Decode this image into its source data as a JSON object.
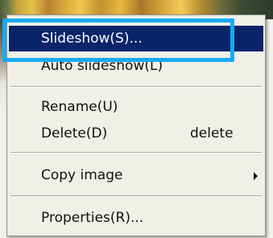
{
  "menu": {
    "items": [
      {
        "label": "Slideshow(S)...",
        "shortcut": "",
        "selected": true,
        "submenu": false
      },
      {
        "label": "Auto slideshow(L)",
        "shortcut": "",
        "selected": false,
        "submenu": false
      },
      {
        "label": "Rename(U)",
        "shortcut": "",
        "selected": false,
        "submenu": false
      },
      {
        "label": "Delete(D)",
        "shortcut": "delete",
        "selected": false,
        "submenu": false
      },
      {
        "label": "Copy image",
        "shortcut": "",
        "selected": false,
        "submenu": true
      },
      {
        "label": "Properties(R)...",
        "shortcut": "",
        "selected": false,
        "submenu": false
      }
    ]
  },
  "colors": {
    "selection_bg": "#0a246a",
    "selection_text": "#ffffff",
    "highlight_border": "#19aaf0",
    "menu_bg": "#f0efe8"
  },
  "icons": {
    "submenu_arrow": "triangle-right-icon"
  }
}
